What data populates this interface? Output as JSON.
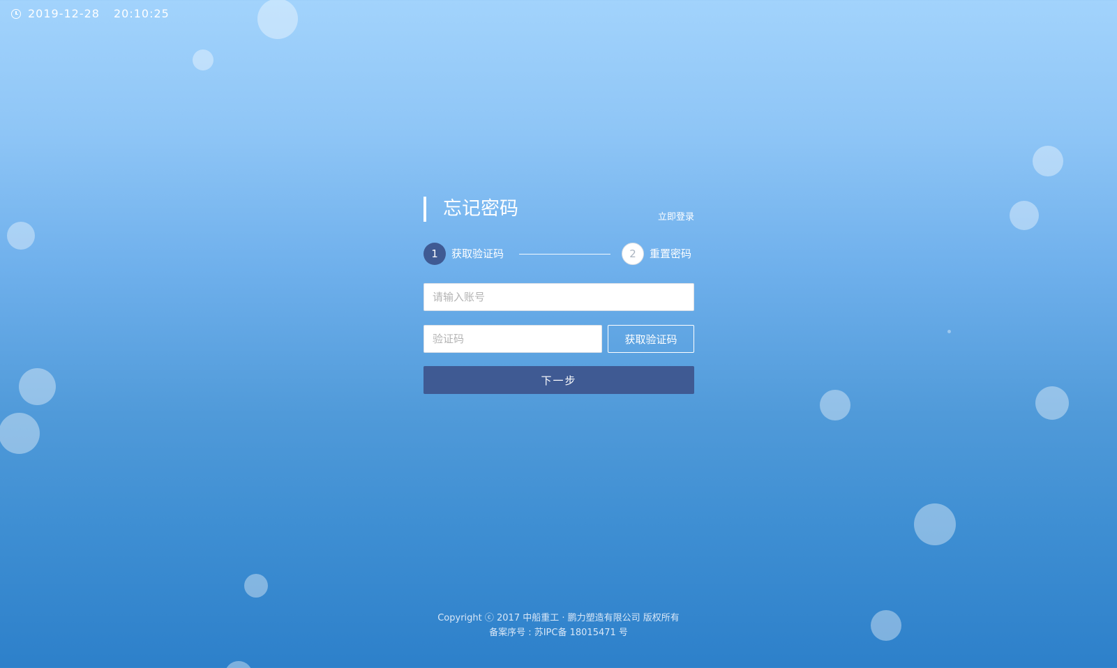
{
  "clock": {
    "date": "2019-12-28",
    "time": "20:10:25",
    "icon": "clock-icon"
  },
  "form": {
    "title": "忘记密码",
    "login_link": "立即登录",
    "steps": [
      {
        "number": "1",
        "label": "获取验证码",
        "state": "active"
      },
      {
        "number": "2",
        "label": "重置密码",
        "state": "inactive"
      }
    ],
    "account_placeholder": "请输入账号",
    "account_value": "",
    "code_placeholder": "验证码",
    "code_value": "",
    "get_code_label": "获取验证码",
    "next_label": "下一步"
  },
  "footer": {
    "copyright": "Copyright ⓒ 2017 中船重工 · 鹏力塑造有限公司 版权所有",
    "icp": "备案序号 : 苏IPC备 18015471 号"
  },
  "colors": {
    "accent": "#3f5a93",
    "background_top": "#a2d3fc",
    "background_bottom": "#2d80ca"
  }
}
